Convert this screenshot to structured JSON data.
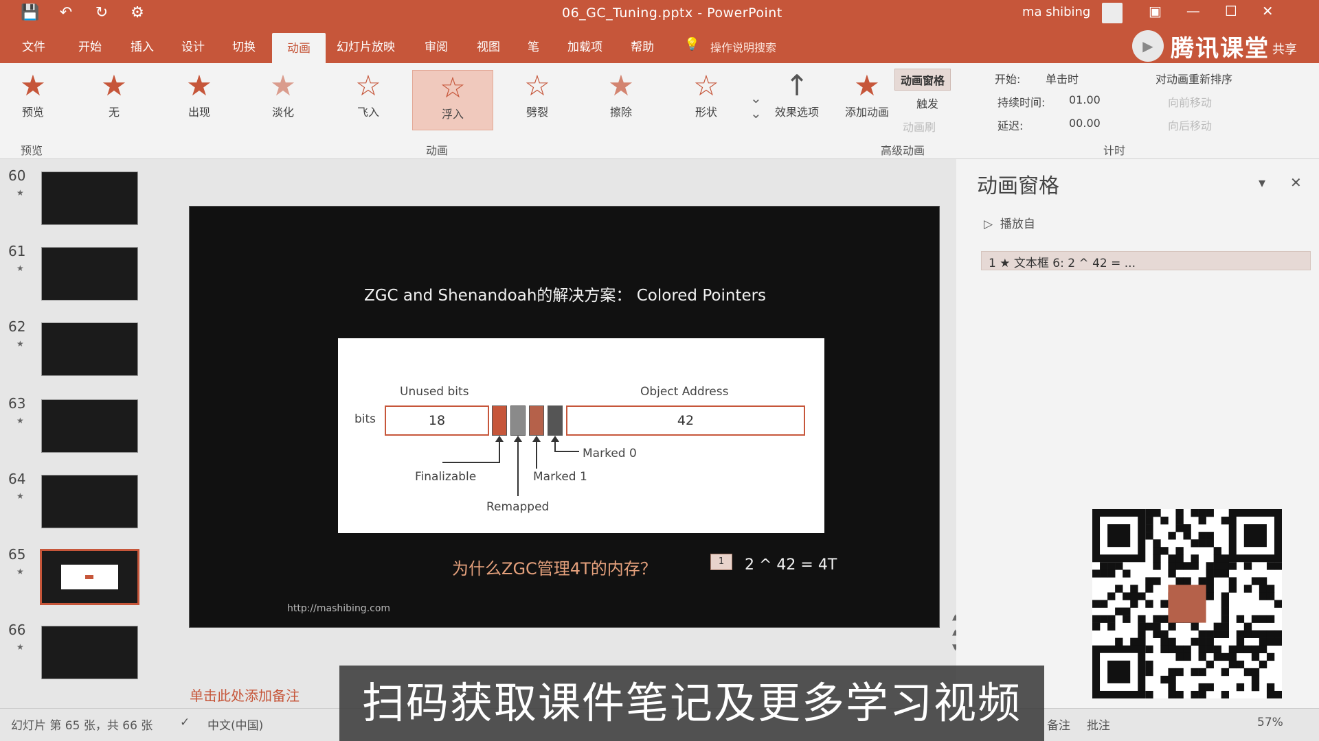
{
  "titlebar": {
    "doc_title": "06_GC_Tuning.pptx  -  PowerPoint",
    "user": "ma shibing",
    "qat_icons": [
      "save-icon",
      "undo-icon",
      "redo-icon",
      "customize-icon"
    ]
  },
  "tabs": {
    "file": "文件",
    "home": "开始",
    "insert": "插入",
    "design": "设计",
    "transitions": "切换",
    "animations": "动画",
    "slideshow": "幻灯片放映",
    "review": "审阅",
    "view": "视图",
    "pen": "笔",
    "addins": "加载项",
    "help": "帮助",
    "tellme": "操作说明搜索"
  },
  "brand": {
    "name": "腾讯课堂",
    "share": "共享"
  },
  "ribbon": {
    "preview": "预览",
    "effects": [
      "无",
      "出现",
      "淡化",
      "飞入",
      "浮入",
      "劈裂",
      "擦除",
      "形状"
    ],
    "effect_options": "效果选项",
    "add_animation": "添加动画",
    "animation_pane": "动画窗格",
    "trigger": "触发",
    "animation_painter": "动画刷",
    "groups": {
      "preview": "预览",
      "animation": "动画",
      "advanced": "高级动画",
      "timing": "计时"
    },
    "timing": {
      "start_label": "开始:",
      "start_value": "单击时",
      "duration_label": "持续时间:",
      "duration_value": "01.00",
      "delay_label": "延迟:",
      "delay_value": "00.00",
      "reorder": "对动画重新排序",
      "move_earlier": "向前移动",
      "move_later": "向后移动"
    }
  },
  "thumbnails": [
    {
      "num": "60",
      "star": "★"
    },
    {
      "num": "61",
      "star": "★"
    },
    {
      "num": "62",
      "star": "★"
    },
    {
      "num": "63",
      "star": "★"
    },
    {
      "num": "64",
      "star": "★"
    },
    {
      "num": "65",
      "star": "★"
    },
    {
      "num": "66",
      "star": "★"
    }
  ],
  "slide": {
    "title": "ZGC and Shenandoah的解决方案：  Colored Pointers",
    "diagram": {
      "unused_bits": "Unused bits",
      "object_address": "Object Address",
      "bits": "bits",
      "unused_value": "18",
      "address_value": "42",
      "finalizable": "Finalizable",
      "remapped": "Remapped",
      "marked1": "Marked 1",
      "marked0": "Marked 0"
    },
    "question": "为什么ZGC管理4T的内存？",
    "anim_tag": "1",
    "answer": "2 ^ 42 = 4T",
    "url": "http://mashibing.com"
  },
  "anim_pane": {
    "title": "动画窗格",
    "play_from": "播放自",
    "item": "1  ★  文本框 6: 2 ^ 42 = ..."
  },
  "notes_placeholder": "单击此处添加备注",
  "banner": "扫码获取课件笔记及更多学习视频",
  "status": {
    "slide_info": "幻灯片 第 65 张，共 66 张",
    "language": "中文(中国)",
    "notes_btn": "备注",
    "comments_btn": "批注",
    "zoom": "57%"
  },
  "colors": {
    "accent": "#c6563a",
    "ribbon_bg": "#f3f3f3",
    "slide_bg": "#111111"
  }
}
